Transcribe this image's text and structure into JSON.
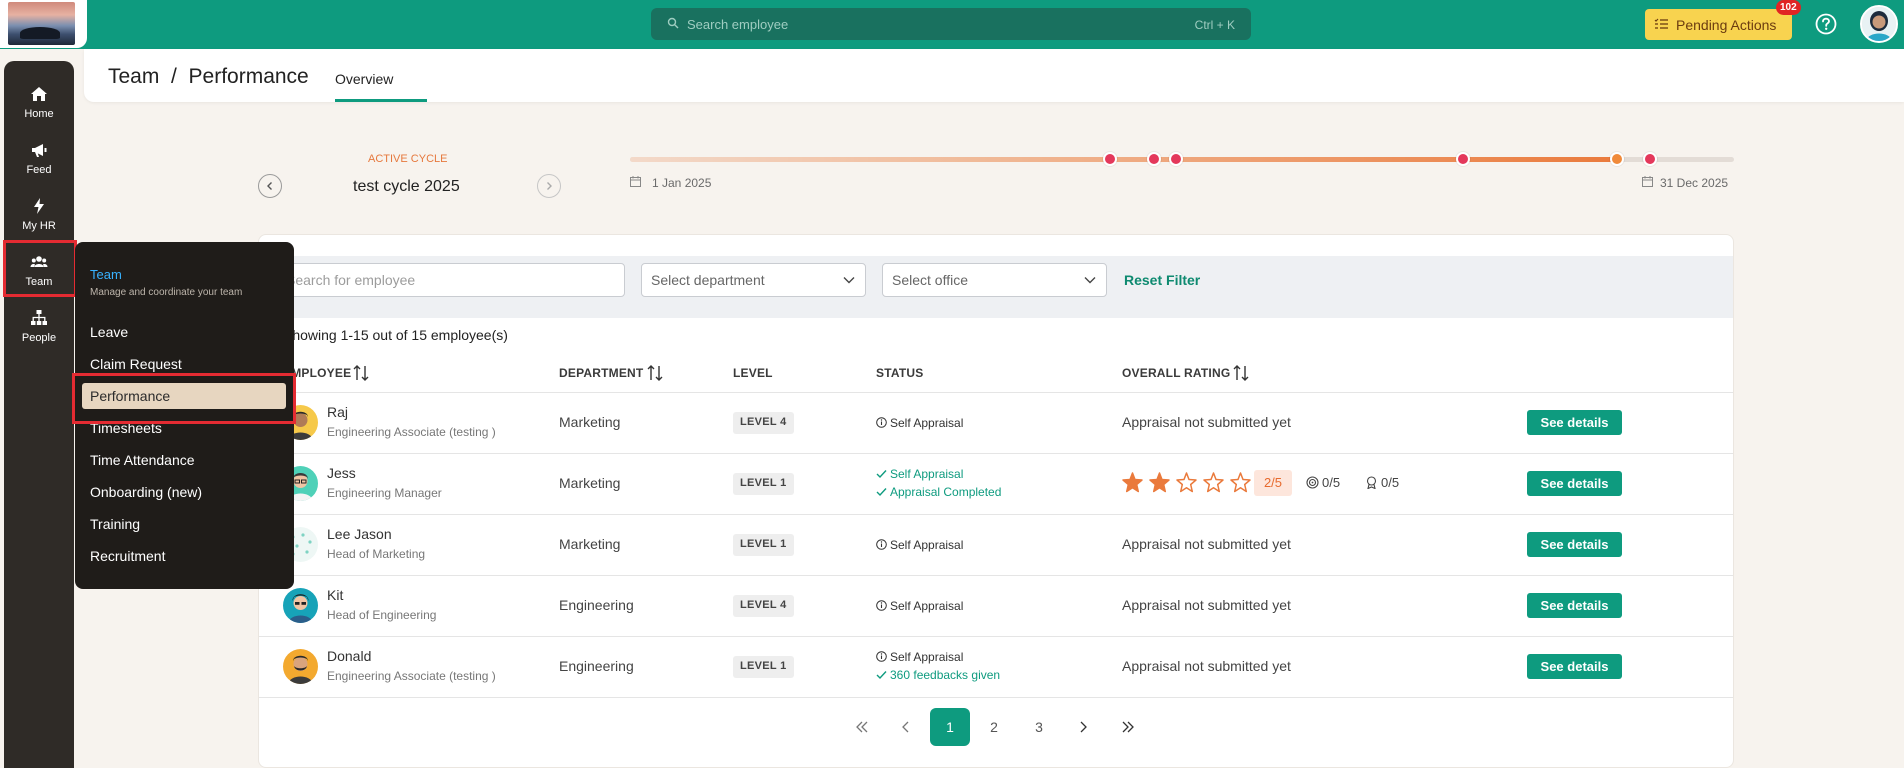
{
  "topbar": {
    "search_placeholder": "Search employee",
    "search_shortcut": "Ctrl + K",
    "pending_label": "Pending Actions",
    "pending_badge": "102"
  },
  "sidebar": {
    "items": [
      {
        "label": "Home",
        "icon": "home-icon"
      },
      {
        "label": "Feed",
        "icon": "megaphone-icon"
      },
      {
        "label": "My HR",
        "icon": "lightning-icon"
      },
      {
        "label": "Team",
        "icon": "users-icon"
      },
      {
        "label": "People",
        "icon": "org-chart-icon"
      }
    ]
  },
  "flyout": {
    "title": "Team",
    "subtitle": "Manage and coordinate your team",
    "items": [
      "Leave",
      "Claim Request",
      "Performance",
      "Timesheets",
      "Time Attendance",
      "Onboarding (new)",
      "Training",
      "Recruitment"
    ],
    "active": "Performance"
  },
  "header": {
    "breadcrumb": "Team  /  Performance",
    "tab": "Overview"
  },
  "cycle": {
    "active_label": "ACTIVE CYCLE",
    "name": "test cycle 2025",
    "start_date": "1 Jan 2025",
    "end_date": "31 Dec 2025",
    "progress": 0.897
  },
  "filters": {
    "search_placeholder": "Search for employee",
    "department": "Select department",
    "office": "Select office",
    "reset": "Reset Filter"
  },
  "table": {
    "count_text": "Showing 1-15 out of 15 employee(s)",
    "headers": {
      "employee": "EMPLOYEE",
      "department": "DEPARTMENT",
      "level": "LEVEL",
      "status": "STATUS",
      "rating": "OVERALL RATING"
    },
    "details_label": "See details",
    "rows": [
      {
        "name": "Raj",
        "role": "Engineering Associate (testing )",
        "department": "Marketing",
        "level": "LEVEL 4",
        "status1": "Self Appraisal",
        "status2": "",
        "rating": "Appraisal not submitted yet"
      },
      {
        "name": "Jess",
        "role": "Engineering Manager",
        "department": "Marketing",
        "level": "LEVEL 1",
        "status1": "Self Appraisal",
        "status2": "Appraisal Completed",
        "rating": "",
        "stars": 2,
        "score": "2/5",
        "goal_score": "0/5",
        "competency_score": "0/5"
      },
      {
        "name": "Lee Jason",
        "role": "Head of Marketing",
        "department": "Marketing",
        "level": "LEVEL 1",
        "status1": "Self Appraisal",
        "status2": "",
        "rating": "Appraisal not submitted yet"
      },
      {
        "name": "Kit",
        "role": "Head of Engineering",
        "department": "Engineering",
        "level": "LEVEL 4",
        "status1": "Self Appraisal",
        "status2": "",
        "rating": "Appraisal not submitted yet"
      },
      {
        "name": "Donald",
        "role": "Engineering Associate (testing )",
        "department": "Engineering",
        "level": "LEVEL 1",
        "status1": "Self Appraisal",
        "status2": "360 feedbacks given",
        "rating": "Appraisal not submitted yet"
      }
    ]
  },
  "pagination": {
    "pages": [
      "1",
      "2",
      "3"
    ],
    "current": "1"
  },
  "colors": {
    "brand": "#0e9b7f",
    "accent_orange": "#ea7a3c",
    "highlight_red": "#e42b32"
  }
}
